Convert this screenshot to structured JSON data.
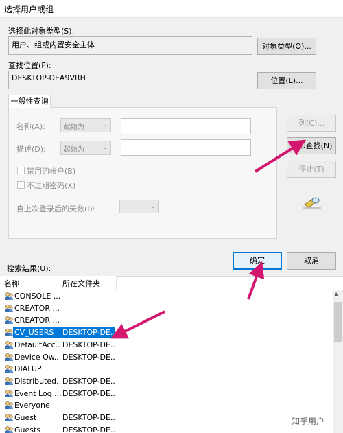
{
  "window": {
    "title": "选择用户或组"
  },
  "object_type": {
    "label": "选择此对象类型(S):",
    "value": "用户、组或内置安全主体",
    "button": "对象类型(O)..."
  },
  "location": {
    "label": "查找位置(F):",
    "value": "DESKTOP-DEA9VRH",
    "button": "位置(L)..."
  },
  "general_query": {
    "tab": "一般性查询",
    "name_label": "名称(A):",
    "name_combo": "起始为",
    "desc_label": "描述(D):",
    "desc_combo": "起始为",
    "disabled_accounts": "禁用的帐户(B)",
    "non_expiring": "不过期密码(X)",
    "days_label": "自上次登录后的天数(I):"
  },
  "side_buttons": {
    "columns": "列(C)...",
    "find_now": "立即查找(N)",
    "stop": "停止(T)"
  },
  "footer": {
    "ok": "确定",
    "cancel": "取消"
  },
  "results": {
    "label": "搜索结果(U):",
    "columns": [
      "名称",
      "所在文件夹"
    ],
    "rows": [
      {
        "name": "CONSOLE ...",
        "folder": "",
        "selected": false
      },
      {
        "name": "CREATOR ...",
        "folder": "",
        "selected": false
      },
      {
        "name": "CREATOR ...",
        "folder": "",
        "selected": false
      },
      {
        "name": "CV_USERS",
        "folder": "DESKTOP-DE...",
        "selected": true
      },
      {
        "name": "DefaultAcc...",
        "folder": "DESKTOP-DE...",
        "selected": false
      },
      {
        "name": "Device Ow...",
        "folder": "DESKTOP-DE...",
        "selected": false
      },
      {
        "name": "DIALUP",
        "folder": "",
        "selected": false
      },
      {
        "name": "Distributed...",
        "folder": "DESKTOP-DE...",
        "selected": false
      },
      {
        "name": "Event Log ...",
        "folder": "DESKTOP-DE...",
        "selected": false
      },
      {
        "name": "Everyone",
        "folder": "",
        "selected": false
      },
      {
        "name": "Guest",
        "folder": "DESKTOP-DE...",
        "selected": false
      },
      {
        "name": "Guests",
        "folder": "DESKTOP-DE...",
        "selected": false
      }
    ]
  },
  "watermark": "知乎用户",
  "colors": {
    "accent": "#0078d7",
    "annotation_arrow": "#d4176e"
  }
}
